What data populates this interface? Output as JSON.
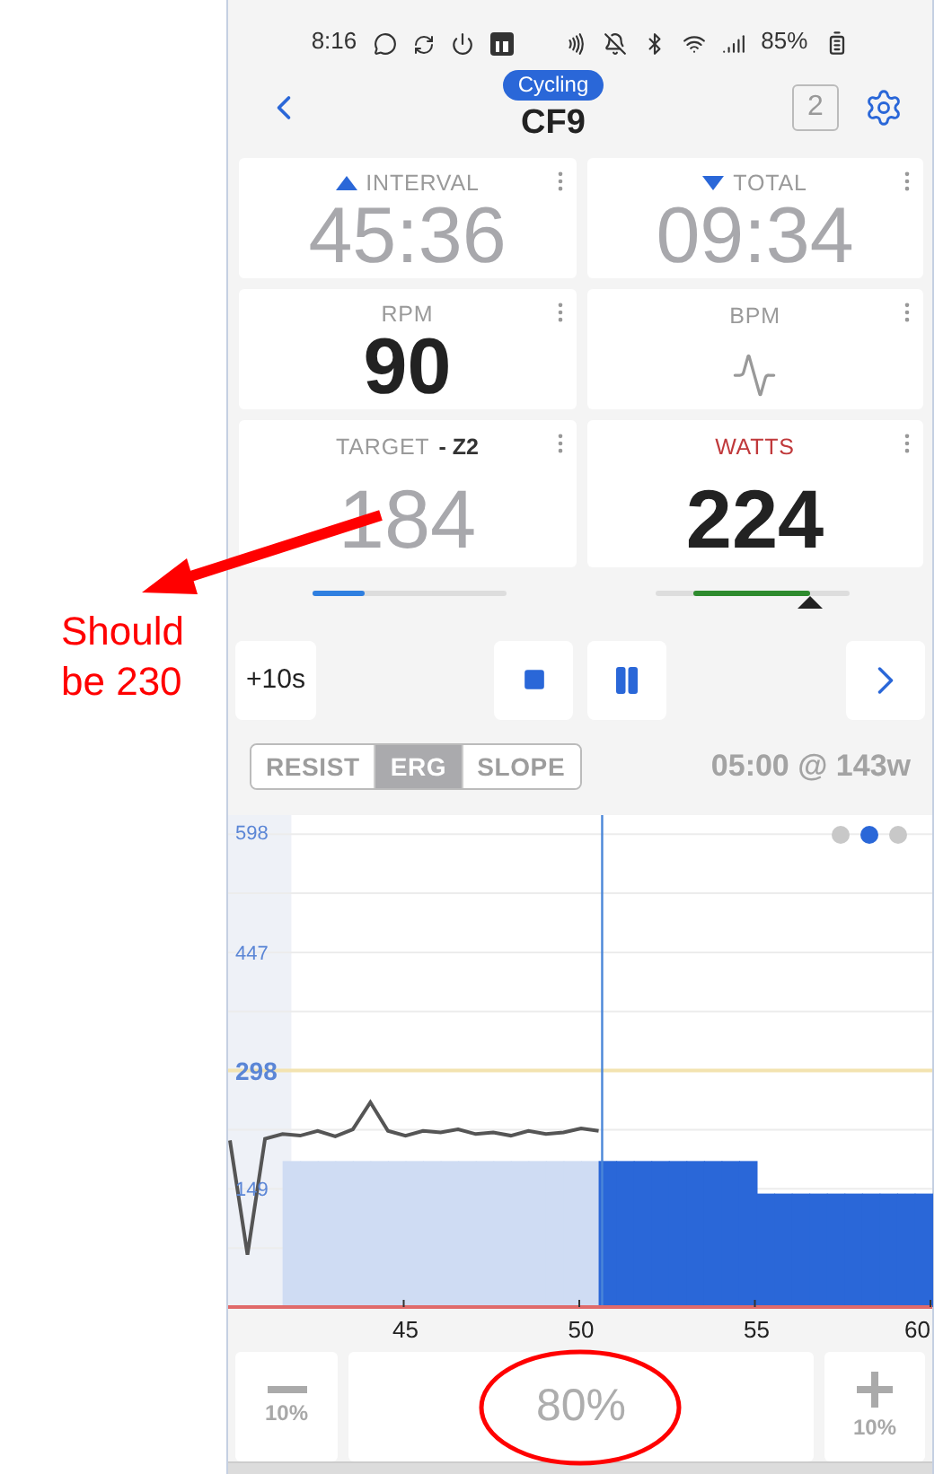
{
  "status_bar": {
    "time": "8:16",
    "battery": "85%"
  },
  "header": {
    "badge": "Cycling",
    "title": "CF9",
    "count": "2"
  },
  "tiles": [
    {
      "kind": "value",
      "label": "INTERVAL",
      "trend": {
        "kind": "up"
      },
      "value": "45:36",
      "muted": true,
      "alert": false
    },
    {
      "kind": "value",
      "label": "TOTAL",
      "trend": {
        "kind": "down"
      },
      "value": "09:34",
      "muted": true,
      "alert": false
    },
    {
      "kind": "value",
      "label": "RPM",
      "value": "90",
      "muted": false,
      "alert": false
    },
    {
      "kind": "pulse",
      "label": "BPM",
      "alert": false
    },
    {
      "kind": "value",
      "label": "TARGET",
      "suffix": "- Z2",
      "value": "184",
      "muted": true,
      "alert": false,
      "bar": {
        "kind": "progress",
        "level": 0.27
      }
    },
    {
      "kind": "value",
      "label": "WATTS",
      "value": "224",
      "muted": false,
      "alert": true,
      "bar": {
        "kind": "range"
      }
    }
  ],
  "controls": {
    "extend": "+10s"
  },
  "modes": [
    {
      "label": "RESIST",
      "selected": false
    },
    {
      "label": "ERG",
      "selected": true
    },
    {
      "label": "SLOPE",
      "selected": false
    }
  ],
  "next_step": "05:00 @ 143w",
  "chart": {
    "pages": [
      {
        "selected": false
      },
      {
        "selected": true
      },
      {
        "selected": false
      }
    ],
    "chart_data": {
      "type": "area",
      "grid": true,
      "x": [
        40,
        40.5,
        41,
        41.5,
        42,
        42.5,
        43,
        43.5,
        44,
        44.5,
        45,
        45.5,
        46,
        46.5,
        47,
        47.5,
        48,
        48.5,
        49,
        49.5,
        50,
        50.5,
        51,
        51.5,
        52,
        52.5,
        53,
        53.5,
        54,
        54.5,
        55,
        55.5,
        56,
        56.5,
        57,
        57.5,
        58,
        58.5,
        59,
        59.5,
        60
      ],
      "series": [
        {
          "color": "#cfdcf3",
          "values": [
            null,
            null,
            null,
            184,
            184,
            184,
            184,
            184,
            184,
            184,
            184,
            184,
            184,
            184,
            184,
            184,
            184,
            184,
            184,
            184,
            184,
            184,
            null,
            null,
            null,
            null,
            null,
            null,
            null,
            null,
            null,
            null,
            null,
            null,
            null,
            null,
            null,
            null,
            null,
            null,
            null
          ]
        },
        {
          "color": "#2a67d8",
          "values": [
            null,
            null,
            null,
            null,
            null,
            null,
            null,
            null,
            null,
            null,
            null,
            null,
            null,
            null,
            null,
            null,
            null,
            null,
            null,
            null,
            null,
            184,
            184,
            184,
            184,
            184,
            184,
            184,
            184,
            184,
            143,
            143,
            143,
            143,
            143,
            143,
            143,
            143,
            143,
            143,
            143
          ]
        },
        {
          "type": "line",
          "color": "#555555",
          "values": [
            210,
            66,
            212,
            218,
            216,
            222,
            215,
            224,
            258,
            222,
            216,
            222,
            220,
            224,
            218,
            220,
            216,
            222,
            218,
            220,
            225,
            222,
            null,
            null,
            null,
            null,
            null,
            null,
            null,
            null,
            null,
            null,
            null,
            null,
            null,
            null,
            null,
            null,
            null,
            null,
            null
          ]
        }
      ],
      "ref_lines": [
        {
          "axis": "y",
          "value": 298,
          "color": "#f3e3b0"
        },
        {
          "axis": "x",
          "value": 50.6,
          "color": "#4a86d8"
        }
      ],
      "bands": [
        {
          "axis": "x",
          "from": 40,
          "to": 41.75,
          "color": "#eef1f7"
        }
      ],
      "xlim": [
        40,
        60
      ],
      "ylim": [
        0,
        620
      ],
      "xticks": [
        45,
        50,
        55,
        60
      ],
      "yticks": [
        149,
        298,
        447,
        598
      ]
    }
  },
  "intensity": {
    "decrease": "10%",
    "value": "80%",
    "increase": "10%"
  },
  "annotation": {
    "text": "Should be 230"
  }
}
